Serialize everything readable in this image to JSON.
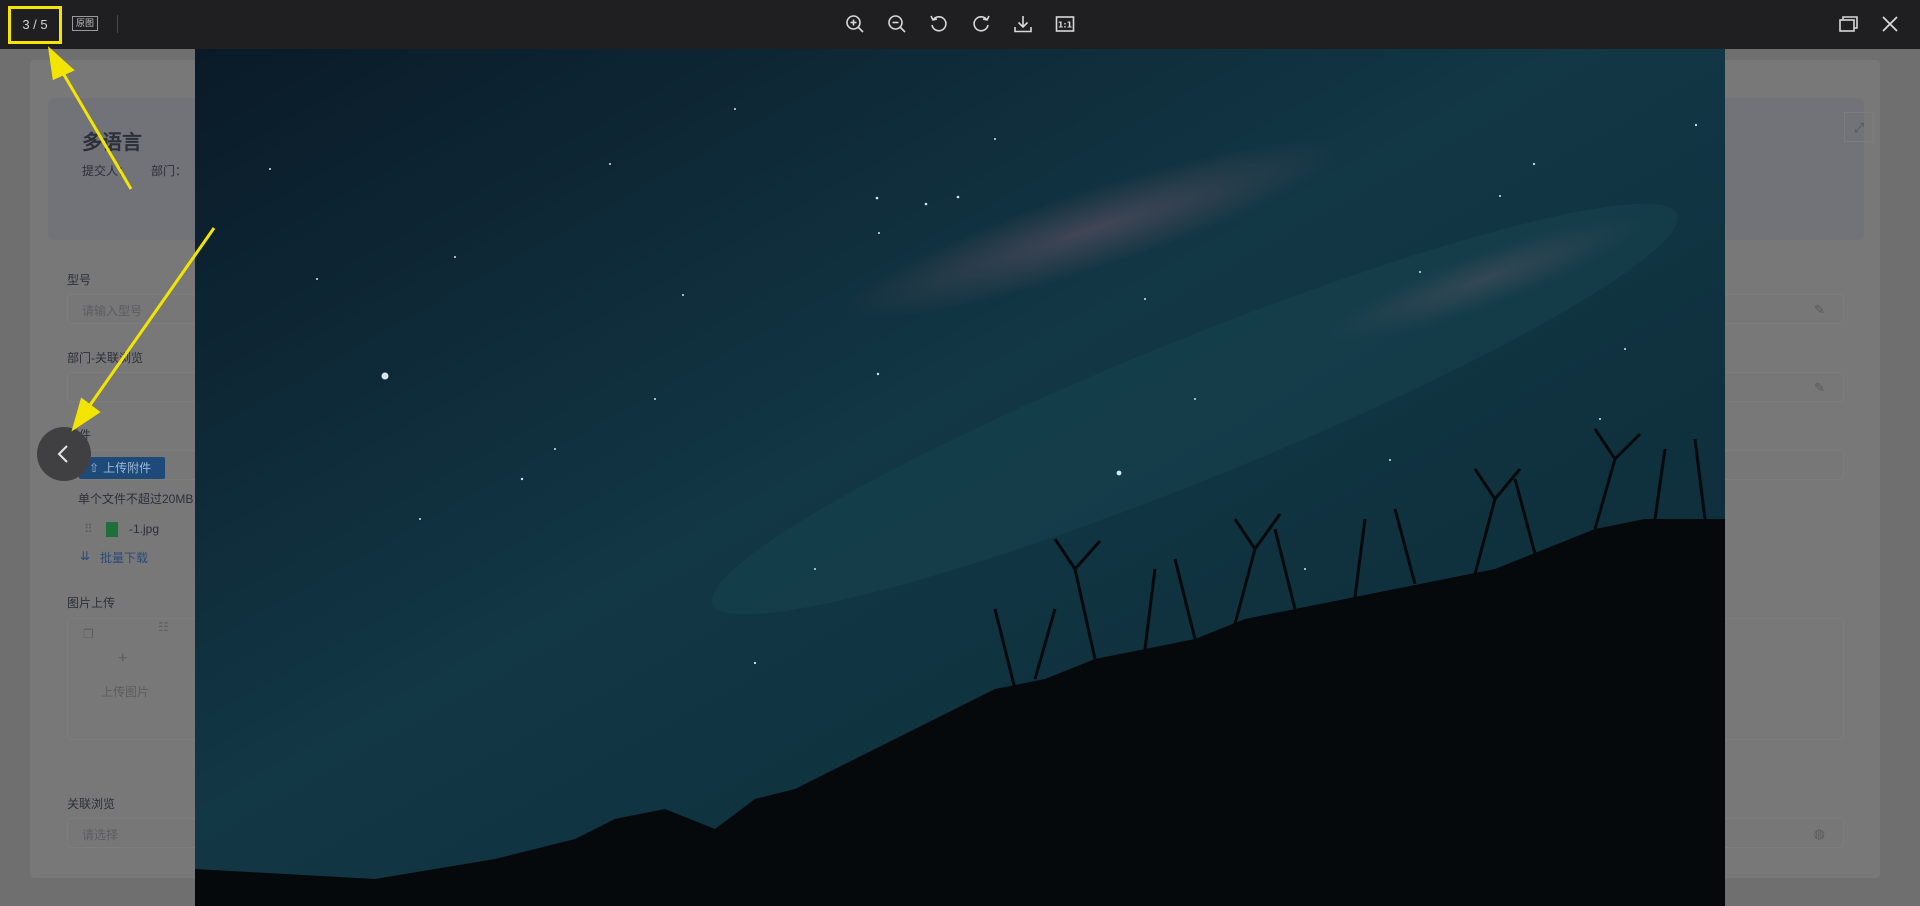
{
  "form": {
    "title": "多语言",
    "submitter_label": "提交人：",
    "department_label": "部门：",
    "fields": [
      {
        "label": "型号",
        "placeholder": "请输入型号"
      },
      {
        "label": "部门-关联浏览",
        "placeholder": ""
      },
      {
        "label": "附件",
        "placeholder": ""
      }
    ],
    "upload_button": "上传附件",
    "upload_hint": "单个文件不超过20MB",
    "file_name": "-1.jpg",
    "batch_download": "批量下载",
    "image_upload_label": "图片上传",
    "image_upload_button": "上传图片",
    "related_browse_label": "关联浏览",
    "related_browse_placeholder": "请选择"
  },
  "viewer": {
    "counter": "3 / 5",
    "original_tag": "原图",
    "tools": [
      "zoom-in-icon",
      "zoom-out-icon",
      "rotate-left-icon",
      "rotate-right-icon",
      "download-icon",
      "actual-size-icon"
    ],
    "actual_size_label": "1:1"
  },
  "colors": {
    "annotation": "#f3e500",
    "toolbar": "#1f1f22",
    "upload_button": "#1e4a7a"
  }
}
